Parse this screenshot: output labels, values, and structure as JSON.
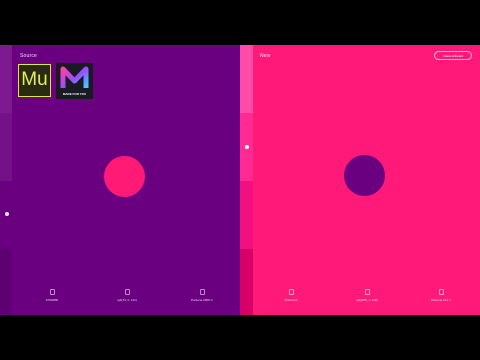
{
  "source": {
    "title": "Source",
    "logo_mu_text": "Mu",
    "logo_m_caption": "MADE FOR YOU",
    "circle_color": "#ff1a75",
    "background": "#6a0080",
    "swatches": [
      {
        "label": "#76008D"
      },
      {
        "label": "rgb(74, 0, 141)"
      },
      {
        "label": "Pantone 2665 C"
      }
    ]
  },
  "new": {
    "title": "New",
    "share_label": "Share Artboard",
    "circle_color": "#6a0080",
    "background": "#ff1a7a",
    "swatches": [
      {
        "label": "#FF1A7A"
      },
      {
        "label": "rgb(255, 1, 119)"
      },
      {
        "label": "Pantone 213 C"
      }
    ]
  }
}
